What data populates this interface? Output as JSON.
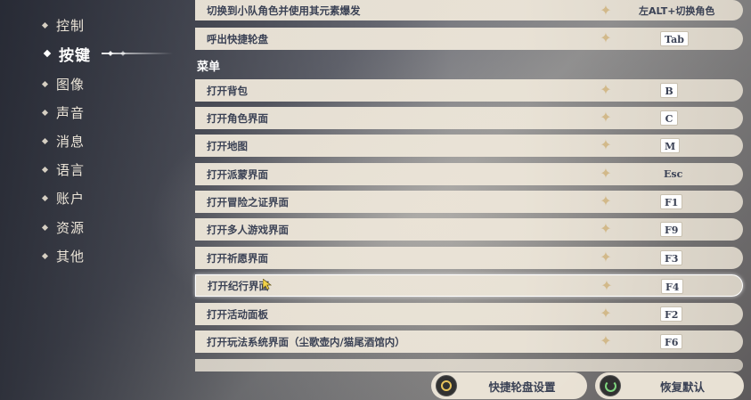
{
  "sidebar": {
    "items": [
      {
        "label": "控制"
      },
      {
        "label": "按键"
      },
      {
        "label": "图像"
      },
      {
        "label": "声音"
      },
      {
        "label": "消息"
      },
      {
        "label": "语言"
      },
      {
        "label": "账户"
      },
      {
        "label": "资源"
      },
      {
        "label": "其他"
      }
    ],
    "active": "按键"
  },
  "rows_top": [
    {
      "label": "切换到小队角色并使用其元素爆发",
      "key": "左ALT+切换角色"
    },
    {
      "label": "呼出快捷轮盘",
      "key": "Tab"
    }
  ],
  "section_menu": "菜单",
  "rows_menu": [
    {
      "label": "打开背包",
      "key": "B"
    },
    {
      "label": "打开角色界面",
      "key": "C"
    },
    {
      "label": "打开地图",
      "key": "M"
    },
    {
      "label": "打开派蒙界面",
      "key": "Esc"
    },
    {
      "label": "打开冒险之证界面",
      "key": "F1"
    },
    {
      "label": "打开多人游戏界面",
      "key": "F9"
    },
    {
      "label": "打开祈愿界面",
      "key": "F3"
    },
    {
      "label": "打开纪行界面",
      "key": "F4"
    },
    {
      "label": "打开活动面板",
      "key": "F2"
    },
    {
      "label": "打开玩法系统界面（尘歌壶内/猫尾酒馆内）",
      "key": "F6"
    }
  ],
  "buttons": {
    "wheel_settings": "快捷轮盘设置",
    "restore_default": "恢复默认"
  },
  "colors": {
    "row_bg": "#ece5d8",
    "text": "#3b4255",
    "accent_gold": "#d2b98a"
  }
}
